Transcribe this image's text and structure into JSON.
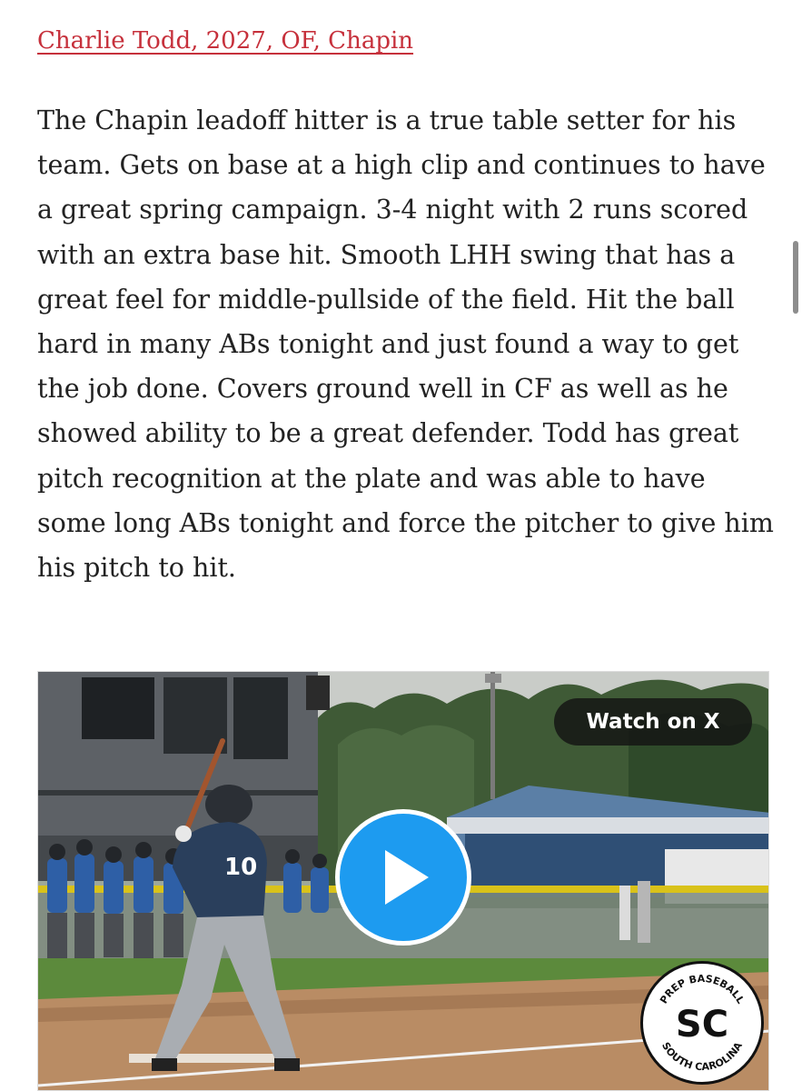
{
  "article": {
    "headline": "Charlie Todd, 2027, OF, Chapin",
    "body": "The Chapin leadoff hitter is a true table setter for his team. Gets on base at a high clip and continues to have a great spring campaign. 3-4 night with 2 runs scored with an extra base hit. Smooth LHH swing that has a great feel for middle-pullside of the field. Hit the ball hard in many ABs tonight and just found a way to get the job done. Covers ground well in CF as well as he showed ability to be a great defender. Todd has great pitch recognition at the plate and was able to have some long ABs tonight and force the pitcher to give him his pitch to hit."
  },
  "video": {
    "watch_label": "Watch on X",
    "jersey_number": "10",
    "logo": {
      "top_text": "PREP BASEBALL",
      "bottom_text": "SOUTH CAROLINA",
      "monogram": "SC"
    }
  },
  "colors": {
    "headline": "#c6303b",
    "play_button": "#1d9bf0"
  }
}
